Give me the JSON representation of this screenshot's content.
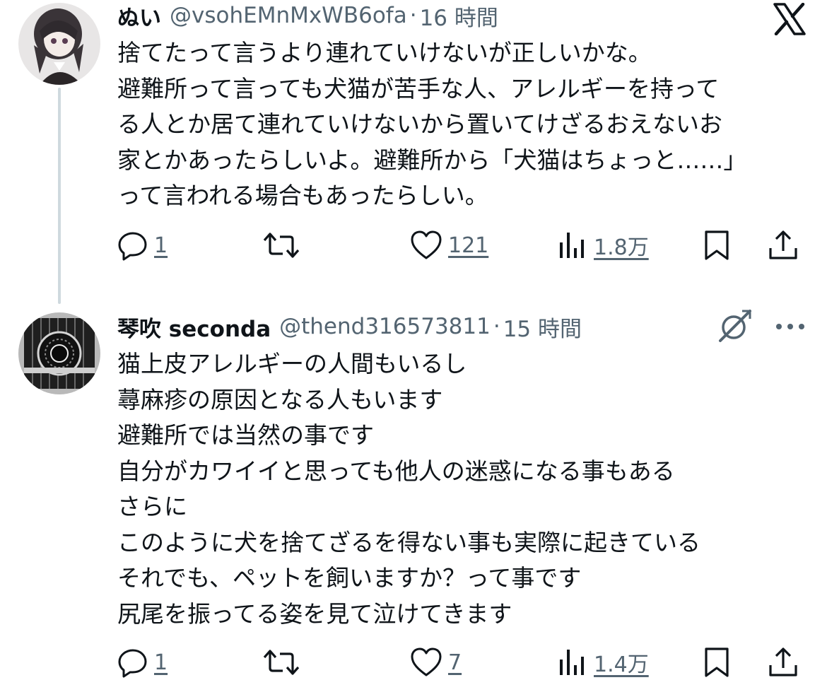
{
  "tweets": [
    {
      "display_name": "ぬい",
      "handle": "@vsohEMnMxWB6ofa",
      "separator": "·",
      "time": "16 時間",
      "lines": [
        "捨てたって言うより連れていけないが正しいかな。",
        "避難所って言っても犬猫が苦手な人、アレルギーを持って",
        "る人とか居て連れていけないから置いてけざるおえないお",
        "家とかあったらしいよ。避難所から「犬猫はちょっと……」",
        "って言われる場合もあったらしい。"
      ],
      "replies": "1",
      "likes": "121",
      "views": "1.8万"
    },
    {
      "display_name": "琴吹 seconda",
      "handle": "@thend316573811",
      "separator": "·",
      "time": "15 時間",
      "lines": [
        "猫上皮アレルギーの人間もいるし",
        "蕁麻疹の原因となる人もいます",
        "避難所では当然の事です",
        "自分がカワイイと思っても他人の迷惑になる事もある",
        "さらに",
        "このように犬を捨てざるを得ない事も実際に起きている",
        "それでも、ペットを飼いますか？って事です",
        "尻尾を振ってる姿を見て泣けてきます"
      ],
      "replies": "1",
      "likes": "7",
      "views": "1.4万"
    }
  ],
  "icons": {
    "reply": "reply-icon",
    "retweet": "retweet-icon",
    "like": "heart-icon",
    "views": "views-icon",
    "bookmark": "bookmark-icon",
    "share": "share-icon",
    "x_logo": "x-logo-icon",
    "grok": "grok-icon",
    "more": "more-icon"
  },
  "colors": {
    "text": "#0f1419",
    "secondary": "#536471",
    "thread_line": "#cfd9de"
  }
}
